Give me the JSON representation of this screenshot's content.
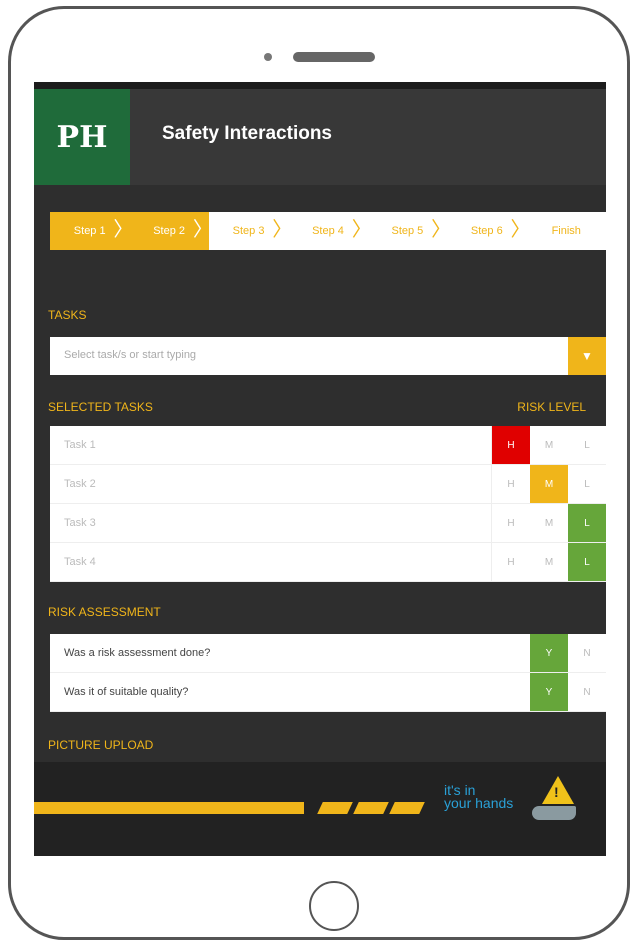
{
  "app": {
    "title": "Safety Interactions",
    "logo_text": "PH"
  },
  "steps": [
    "Step 1",
    "Step 2",
    "Step 3",
    "Step 4",
    "Step 5",
    "Step 6",
    "Finish"
  ],
  "active_steps": 2,
  "tasks": {
    "section_label": "TASKS",
    "placeholder": "Select task/s or start typing",
    "selected_label": "SELECTED TASKS",
    "risk_level_label": "RISK LEVEL",
    "rows": [
      {
        "name": "Task 1",
        "risk": "H"
      },
      {
        "name": "Task 2",
        "risk": "M"
      },
      {
        "name": "Task 3",
        "risk": "L"
      },
      {
        "name": "Task 4",
        "risk": "L"
      }
    ],
    "risk_labels": {
      "h": "H",
      "m": "M",
      "l": "L"
    }
  },
  "risk_assessment": {
    "section_label": "RISK ASSESSMENT",
    "questions": [
      {
        "text": "Was a risk assessment done?",
        "answer": "Y"
      },
      {
        "text": "Was it of suitable quality?",
        "answer": "Y"
      }
    ],
    "yes_label": "Y",
    "no_label": "N"
  },
  "picture_upload": {
    "section_label": "PICTURE UPLOAD"
  },
  "footer": {
    "brand_line1": "it's in",
    "brand_line2": "your hands"
  },
  "colors": {
    "accent": "#f0b51a",
    "high": "#e00000",
    "medium": "#f0b51a",
    "low": "#66a63a",
    "logo_bg": "#1f6b3a"
  }
}
